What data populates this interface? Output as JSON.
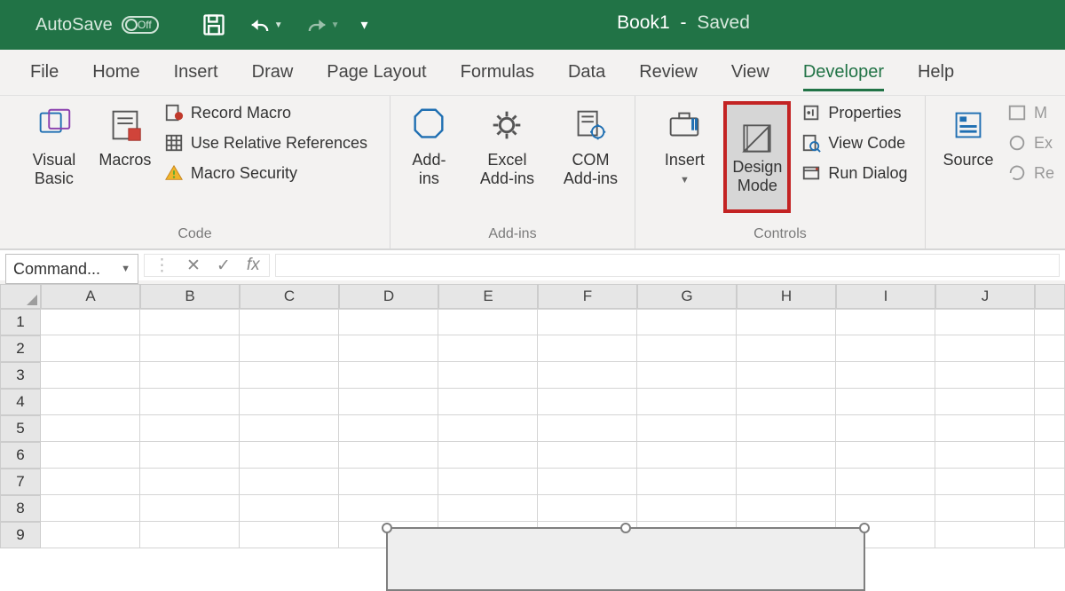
{
  "titlebar": {
    "autosave_label": "AutoSave",
    "autosave_state": "Off",
    "book": "Book1",
    "sep": "-",
    "status": "Saved"
  },
  "tabs": [
    "File",
    "Home",
    "Insert",
    "Draw",
    "Page Layout",
    "Formulas",
    "Data",
    "Review",
    "View",
    "Developer",
    "Help"
  ],
  "active_tab": "Developer",
  "ribbon": {
    "code": {
      "group_label": "Code",
      "visual_basic": "Visual\nBasic",
      "macros": "Macros",
      "record_macro": "Record Macro",
      "use_relative": "Use Relative References",
      "macro_security": "Macro Security"
    },
    "addins": {
      "group_label": "Add-ins",
      "addins": "Add-\nins",
      "excel_addins": "Excel\nAdd-ins",
      "com_addins": "COM\nAdd-ins"
    },
    "controls": {
      "group_label": "Controls",
      "insert": "Insert",
      "design_mode": "Design\nMode",
      "properties": "Properties",
      "view_code": "View Code",
      "run_dialog": "Run Dialog"
    },
    "misc": {
      "source": "Source",
      "m": "M",
      "ex": "Ex",
      "re": "Re"
    }
  },
  "namebox": "Command...",
  "fx_label": "fx",
  "columns": [
    "A",
    "B",
    "C",
    "D",
    "E",
    "F",
    "G",
    "H",
    "I",
    "J"
  ],
  "rows": [
    "1",
    "2",
    "3",
    "4",
    "5",
    "6",
    "7",
    "8",
    "9"
  ],
  "highlighted_button": "design_mode"
}
